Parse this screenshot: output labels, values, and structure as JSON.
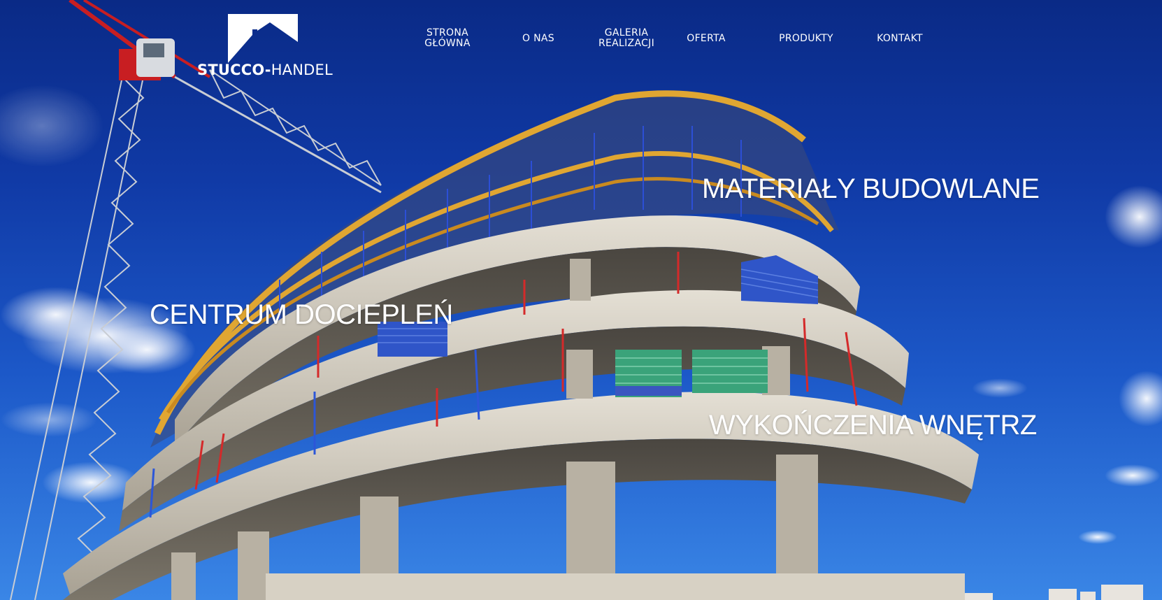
{
  "logo": {
    "brand_bold": "STUCCO-",
    "brand_light": "HANDEL"
  },
  "nav": {
    "items": [
      {
        "label": "STRONA\nGŁÓWNA"
      },
      {
        "label": "O NAS"
      },
      {
        "label": "GALERIA\nREALIZACJI"
      },
      {
        "label": "OFERTA"
      },
      {
        "label": "PRODUKTY"
      },
      {
        "label": "KONTAKT"
      }
    ]
  },
  "hero": {
    "labels": {
      "materialy": "MATERIAŁY BUDOWLANE",
      "centrum": "CENTRUM DOCIEPLEŃ",
      "wykonczenia": "WYKOŃCZENIA WNĘTRZ"
    }
  },
  "colors": {
    "sky_top": "#0a2a86",
    "sky_bottom": "#3a86e6",
    "text": "#ffffff",
    "crane": "#c8ccd4",
    "crane_red": "#c81e22",
    "concrete": "#cfc9bd",
    "formwork": "#d69a28"
  }
}
